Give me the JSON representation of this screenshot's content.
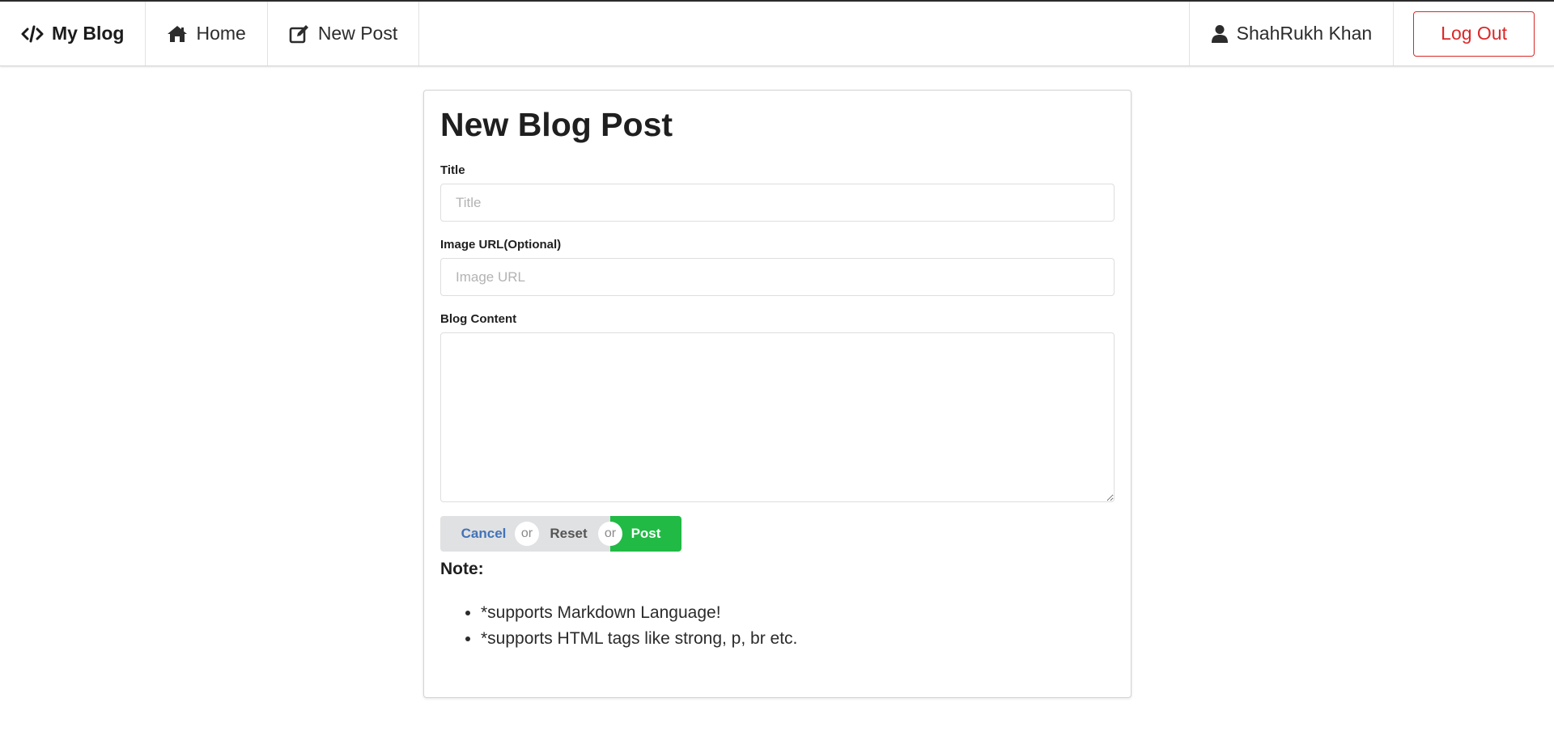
{
  "navbar": {
    "brand_label": "My Blog",
    "home_label": "Home",
    "new_post_label": "New Post",
    "user_name": "ShahRukh Khan",
    "logout_label": "Log Out",
    "icons": {
      "brand": "code-icon",
      "home": "home-icon",
      "new_post": "edit-icon",
      "user": "user-icon"
    },
    "logout_color": "#db2828"
  },
  "form": {
    "page_title": "New Blog Post",
    "title_label": "Title",
    "title_value": "",
    "title_placeholder": "Title",
    "image_label": "Image URL(Optional)",
    "image_value": "",
    "image_placeholder": "Image URL",
    "content_label": "Blog Content",
    "content_value": ""
  },
  "buttons": {
    "cancel_label": "Cancel",
    "or_label": "or",
    "reset_label": "Reset",
    "post_label": "Post",
    "post_color": "#21ba45",
    "cancel_color": "#4273b8"
  },
  "note": {
    "title": "Note:",
    "items": [
      "*supports Markdown Language!",
      "*supports HTML tags like strong, p, br etc."
    ]
  }
}
